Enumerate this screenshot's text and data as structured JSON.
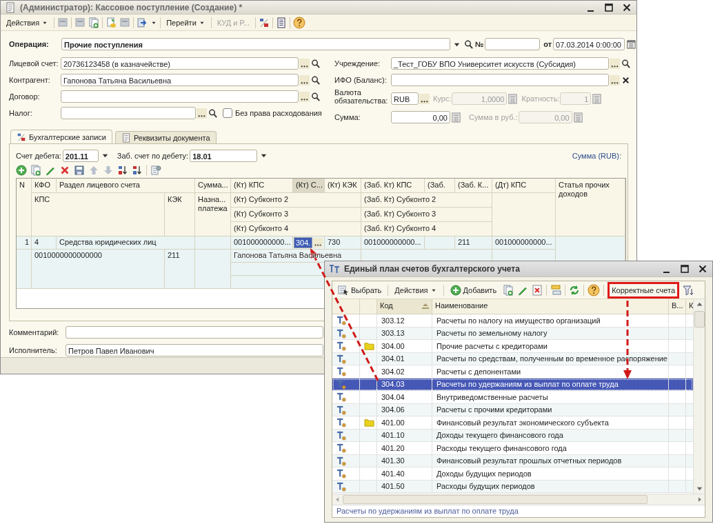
{
  "main_window": {
    "title": "(Администратор): Кассовое поступление (Создание) *",
    "toolbar": [
      {
        "kind": "menu",
        "label": "Действия",
        "disabled": false
      },
      {
        "kind": "menu",
        "label": "Перейти",
        "disabled": false
      },
      {
        "kind": "button",
        "label": "КУД и Р...",
        "disabled": true
      }
    ],
    "operation": {
      "label": "Операция:",
      "value": "Прочие поступления"
    },
    "number": {
      "label": "№"
    },
    "date": {
      "label": "от",
      "value": "07.03.2014  0:00:00"
    },
    "left_fields": [
      {
        "label": "Лицевой счет:",
        "value": "20736123458 (в казначействе)"
      },
      {
        "label": "Контрагент:",
        "value": "Гапонова Татьяна Васильевна"
      },
      {
        "label": "Договор:"
      },
      {
        "label": "Налог:"
      }
    ],
    "no_spending_right": {
      "label": "Без права расходования",
      "checked": false
    },
    "institution": {
      "label": "Учреждение:",
      "value": "_Тест_ГОБУ ВПО Университет искусств (Субсидия)"
    },
    "ifo": {
      "label": "ИФО (Баланс):"
    },
    "currency": {
      "label": "Валюта обязательства:",
      "value": "RUB"
    },
    "rate": {
      "label": "Курс:",
      "value": "1,0000",
      "disabled": true
    },
    "multiplicity": {
      "label": "Кратность:",
      "value": "1",
      "disabled": true
    },
    "sum": {
      "label": "Сумма:",
      "value": "0,00",
      "disabled": false
    },
    "sum_rub": {
      "label": "Сумма в руб.:",
      "value": "0,00",
      "disabled": true
    },
    "tabs": [
      {
        "label": "Бухгалтерские записи",
        "selected": true
      },
      {
        "label": "Реквизиты документа",
        "selected": false
      }
    ],
    "debit_account": {
      "label": "Счет дебета:",
      "value": "201.11"
    },
    "offbalance_account": {
      "label": "Заб. счет по дебету:",
      "value": "18.01"
    },
    "sum_currency_label": "Сумма (RUB):",
    "table": {
      "header": [
        {
          "text": "N",
          "selected": false
        },
        {
          "text": "КФО",
          "selected": false
        },
        {
          "text": "Раздел лицевого счета",
          "selected": false
        },
        {
          "text": "Сумма...",
          "selected": false
        },
        {
          "text": "(Кт) КПС",
          "selected": false
        },
        {
          "text": "(Кт) С...",
          "selected": true
        },
        {
          "text": "(Кт) КЭК",
          "selected": false
        },
        {
          "text": "(Заб. Кт) КПС",
          "selected": false
        },
        {
          "text": "(Заб.",
          "selected": false
        },
        {
          "text": "(Заб. К...",
          "selected": false
        },
        {
          "text": "(Дт) КПС",
          "selected": false
        },
        {
          "text": "Статья прочих доходов",
          "selected": false
        },
        {
          "text": "КПС",
          "selected": false
        },
        {
          "text": "КЭК",
          "selected": false
        },
        {
          "text": "Назна... платежа",
          "selected": false
        },
        {
          "text": "(Кт) Субконто 2",
          "selected": false
        },
        {
          "text": "(Заб. Кт) Субконто 2",
          "selected": false
        },
        {
          "text": "(Кт) Субконто 3",
          "selected": false
        },
        {
          "text": "(Заб. Кт) Субконто 3",
          "selected": false
        },
        {
          "text": "(Кт) Субконто 4",
          "selected": false
        },
        {
          "text": "(Заб. Кт) Субконто 4",
          "selected": false
        }
      ],
      "rows": [
        {
          "selected": true,
          "n": "1",
          "kfo": "4",
          "section": "Средства юридических лиц",
          "kt_kps": "001000000000...",
          "kt_account": {
            "value": "304.",
            "selected": true
          },
          "kt_kek": "730",
          "zab_kps": "001000000000...",
          "zab_kek": "211",
          "dt_kps": "001000000000...",
          "kps": "0010000000000000",
          "kek": "211",
          "kt_subconto_2": "Гапонова Татьяна Васильевна"
        }
      ]
    },
    "comment": {
      "label": "Комментарий:"
    },
    "executor": {
      "label": "Исполнитель:",
      "value": "Петров Павел Иванович"
    }
  },
  "chart_window": {
    "title": "Единый план счетов бухгалтерского учета",
    "toolbar": [
      {
        "kind": "button",
        "label": "Выбрать",
        "highlighted": false
      },
      {
        "kind": "menu",
        "label": "Действия",
        "highlighted": false
      },
      {
        "kind": "button",
        "label": "Добавить",
        "highlighted": false
      },
      {
        "kind": "button",
        "label": "Корректные счета",
        "highlighted": true
      }
    ],
    "columns": [
      {
        "label": "Код",
        "sorted": true
      },
      {
        "label": "Наименование",
        "sorted": false
      },
      {
        "label": "В...",
        "sorted": false
      },
      {
        "label": "К",
        "sorted": false
      }
    ],
    "rows": [
      {
        "kind": "account",
        "code": "303.12",
        "name": "Расчеты по налогу на имущество организаций",
        "selected": false
      },
      {
        "kind": "account",
        "code": "303.13",
        "name": "Расчеты по земельному налогу",
        "selected": false
      },
      {
        "kind": "group",
        "code": "304.00",
        "name": "Прочие расчеты с кредиторами",
        "selected": false
      },
      {
        "kind": "account",
        "code": "304.01",
        "name": "Расчеты по средствам, полученным во временное распоряжение",
        "selected": false
      },
      {
        "kind": "account",
        "code": "304.02",
        "name": "Расчеты с депонентами",
        "selected": false
      },
      {
        "kind": "account",
        "code": "304.03",
        "name": "Расчеты по удержаниям из выплат по оплате труда",
        "selected": true
      },
      {
        "kind": "account",
        "code": "304.04",
        "name": "Внутриведомственные расчеты",
        "selected": false
      },
      {
        "kind": "account",
        "code": "304.06",
        "name": "Расчеты с прочими кредиторами",
        "selected": false
      },
      {
        "kind": "group",
        "code": "401.00",
        "name": "Финансовый результат экономического субъекта",
        "selected": false
      },
      {
        "kind": "account",
        "code": "401.10",
        "name": "Доходы текущего финансового года",
        "selected": false
      },
      {
        "kind": "account",
        "code": "401.20",
        "name": "Расходы текущего финансового года",
        "selected": false
      },
      {
        "kind": "account",
        "code": "401.30",
        "name": "Финансовый результат прошлых отчетных периодов",
        "selected": false
      },
      {
        "kind": "account",
        "code": "401.40",
        "name": "Доходы будущих периодов",
        "selected": false
      },
      {
        "kind": "account",
        "code": "401.50",
        "name": "Расходы будущих периодов",
        "selected": false
      }
    ],
    "status": "Расчеты по удержаниям из выплат по оплате труда"
  }
}
